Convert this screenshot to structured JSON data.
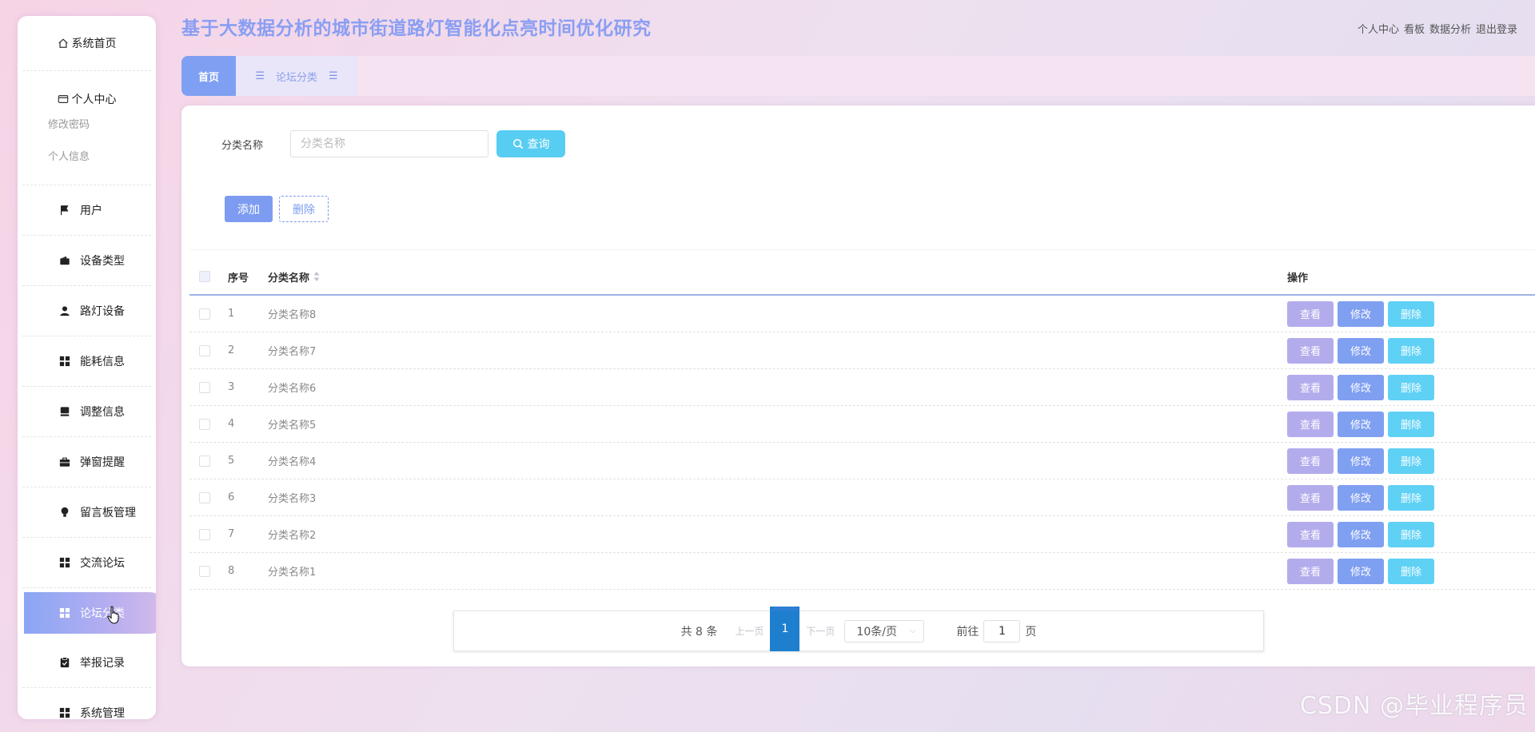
{
  "app": {
    "title": "基于大数据分析的城市街道路灯智能化点亮时间优化研究"
  },
  "top_links": [
    "个人中心",
    "看板",
    "数据分析",
    "退出登录"
  ],
  "sidebar": {
    "home": "系统首页",
    "personal": {
      "label": "个人中心",
      "children": [
        "修改密码",
        "个人信息"
      ]
    },
    "items": [
      {
        "label": "用户",
        "icon": "flag-icon"
      },
      {
        "label": "设备类型",
        "icon": "wallet-icon"
      },
      {
        "label": "路灯设备",
        "icon": "user-icon"
      },
      {
        "label": "能耗信息",
        "icon": "grid-icon"
      },
      {
        "label": "调整信息",
        "icon": "tray-icon"
      },
      {
        "label": "弹窗提醒",
        "icon": "briefcase-icon"
      },
      {
        "label": "留言板管理",
        "icon": "bulb-icon"
      },
      {
        "label": "交流论坛",
        "icon": "grid-icon"
      },
      {
        "label": "论坛分类",
        "icon": "grid-icon",
        "active": true
      },
      {
        "label": "举报记录",
        "icon": "clipboard-icon"
      },
      {
        "label": "系统管理",
        "icon": "grid-icon"
      }
    ]
  },
  "tabs": [
    {
      "label": "首页",
      "active": true
    },
    {
      "label": "论坛分类",
      "active": false
    }
  ],
  "search": {
    "label": "分类名称",
    "placeholder": "分类名称",
    "button": "查询"
  },
  "actions": {
    "add": "添加",
    "delete": "删除"
  },
  "table": {
    "headers": {
      "no": "序号",
      "name": "分类名称",
      "ops": "操作"
    },
    "rows": [
      {
        "no": "1",
        "name": "分类名称8"
      },
      {
        "no": "2",
        "name": "分类名称7"
      },
      {
        "no": "3",
        "name": "分类名称6"
      },
      {
        "no": "4",
        "name": "分类名称5"
      },
      {
        "no": "5",
        "name": "分类名称4"
      },
      {
        "no": "6",
        "name": "分类名称3"
      },
      {
        "no": "7",
        "name": "分类名称2"
      },
      {
        "no": "8",
        "name": "分类名称1"
      }
    ],
    "row_ops": {
      "view": "查看",
      "edit": "修改",
      "delete": "删除"
    }
  },
  "pagination": {
    "total": "共 8 条",
    "prev": "上一页",
    "current": "1",
    "next": "下一页",
    "page_size": "10条/页",
    "goto_label": "前往",
    "goto_value": "1",
    "page_suffix": "页"
  },
  "watermark": "CSDN @毕业程序员",
  "colors": {
    "accent": "#7fa0f2",
    "query": "#58cdf2",
    "view": "#b3acec",
    "edit": "#7f9ff1",
    "delete": "#5fd1f5"
  }
}
